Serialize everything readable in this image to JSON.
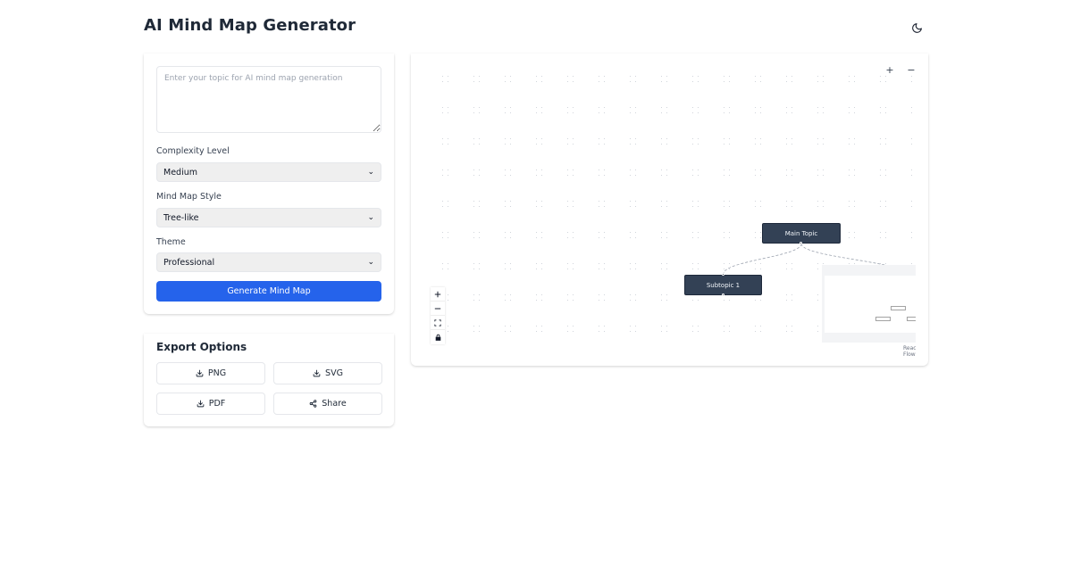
{
  "app": {
    "title": "AI Mind Map Generator"
  },
  "form": {
    "topic_placeholder": "Enter your topic for AI mind map generation",
    "topic_value": "",
    "complexity": {
      "label": "Complexity Level",
      "value": "Medium"
    },
    "style": {
      "label": "Mind Map Style",
      "value": "Tree-like"
    },
    "theme": {
      "label": "Theme",
      "value": "Professional"
    },
    "generate_label": "Generate Mind Map"
  },
  "export": {
    "title": "Export Options",
    "buttons": [
      "PNG",
      "SVG",
      "PDF",
      "Share"
    ]
  },
  "canvas": {
    "zoom_in": "+",
    "zoom_out": "−",
    "nodes": {
      "main": "Main Topic",
      "subtopic1": "Subtopic 1"
    },
    "attribution": "React Flow"
  },
  "colors": {
    "accent": "#2563eb",
    "node_bg": "#334155",
    "dot_grid": "#d1d5db"
  },
  "icons": {
    "theme_toggle": "moon-icon",
    "export": [
      "download-icon",
      "download-icon",
      "download-icon",
      "share-icon"
    ],
    "controls": [
      "plus-icon",
      "minus-icon",
      "fit-view-icon",
      "lock-icon"
    ]
  }
}
